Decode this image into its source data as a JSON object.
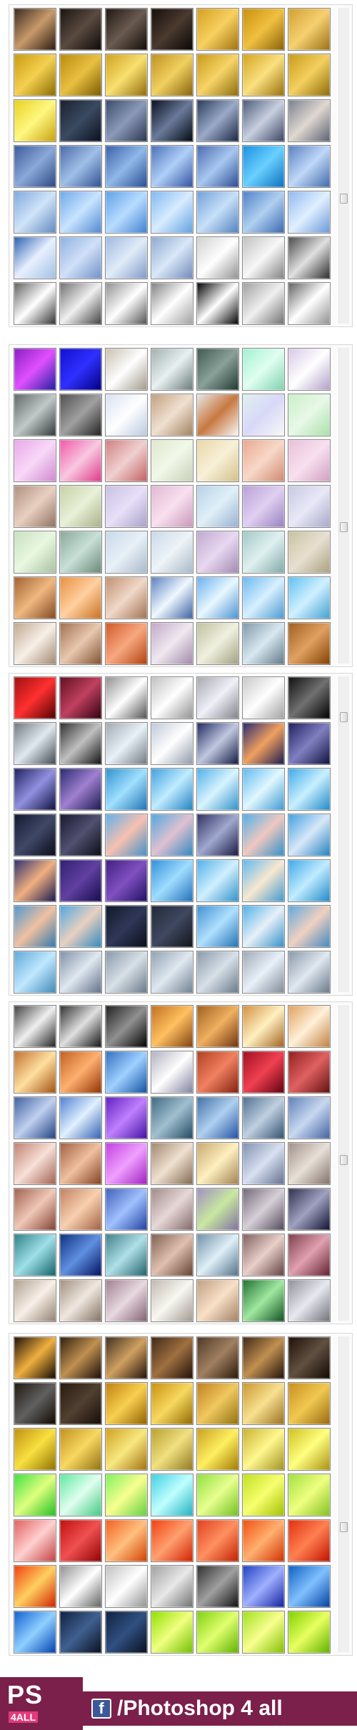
{
  "footer": {
    "logo_ps": "PS",
    "logo_4all": "4ALL",
    "facebook_icon": "f",
    "handle": "/Photoshop 4 all",
    "brand_color": "#7b1f4b"
  },
  "panels": [
    {
      "scroll_fraction": 0.62,
      "swatches": [
        "#3a2a20,#c89a6a,#2a1a10",
        "#1a1410,#5a4a40,#0e0a08",
        "#201812,#6a5a50,#120c08",
        "#160e0a,#4a3a30,#0a0604",
        "#d4a020,#f8d060,#a07010",
        "#c89010,#f0c040,#8a6008",
        "#d0a030,#f6d070,#9a7018",
        "#c89a10,#f4d050,#8a6a00",
        "#b88a10,#e8c040,#7a5a00",
        "#d0a020,#f8e070,#906a08",
        "#c09020,#f0d060,#86620a",
        "#c89818,#f6d468,#8c6a0a",
        "#d4a420,#fae080,#986e0a",
        "#c89a18,#f4d060,#8c6a08",
        "#e8d020,#fff880,#c8a010",
        "#1a2030,#3a4a60,#0a1020",
        "#3a4a6a,#8a9ab8,#2a3450",
        "#0a1020,#6a7a9a,#000810",
        "#2a3a5a,#9aaac8,#1a2440",
        "#4a5a7a,#c8d0e0,#3a4460",
        "#7a8090,#e0d8d0,#5a6070",
        "#3a5a9a,#8aa8d8,#2a4880",
        "#4a6aa8,#a0c0e8,#305090",
        "#3a60a8,#90b8e8,#284c90",
        "#4a70b8,#b0d0f8,#3050a0",
        "#4a6ab0,#a8c8f0,#2a4a90",
        "#1a90e0,#6ad0ff,#0a70c0",
        "#5a80c0,#c0d8f8,#4068a8",
        "#80a8e0,#d0e4f8,#6088c0",
        "#70a8e8,#c8e4ff,#5088d0",
        "#60a0e8,#b8dcff,#4080d0",
        "#80b8f0,#d8ecff,#60a0e0",
        "#70a0d8,#c8e0f8,#5080c0",
        "#5080c8,#b0d0f0,#3a68b0",
        "#90b8f0,#e0f0ff,#6a98d8",
        "#2a60b0,#e8f0ff,#a0c0e0",
        "#90b0e0,#d0e0f8,#7090c8",
        "#a0b8e0,#e0ecf8,#8098c8",
        "#90a8d0,#d8e8f8,#7088b8",
        "#d0d0d0,#ffffff,#909090",
        "#c0c0c0,#f8f8f8,#808080",
        "#4a4a4a,#e0e0e0,#2a2a2a",
        "#606060,#ffffff,#303030",
        "#707070,#f0f0f0,#404040",
        "#909090,#ffffff,#505050",
        "#808080,#ffffff,#a0a0a0",
        "#000000,#ffffff,#000000",
        "#a0a0a0,#f0f0f0,#707070",
        "#606060,#ffffff,#909090"
      ]
    },
    {
      "scroll_fraction": 0.58,
      "swatches": [
        "#8a20c0,#e050ff,#2020a0",
        "#1010d0,#3030ff,#000080",
        "#c8c0b0,#ffffff,#a09888",
        "#a0b0b0,#e8f0f0,#6a7a7a",
        "#405a50,#8aa098,#203a30",
        "#a0f0d0,#e0fff0,#80d0b0",
        "#d8c8e8,#ffffff,#b0a0c8",
        "#606868,#c0c8c8,#303838",
        "#505050,#a0a0a0,#202020",
        "#d8e0f0,#ffffff,#b8c8e0",
        "#c0a080,#f0e0d0,#a08060",
        "#e8e8e8,#c87840,#f8f8f8",
        "#e0f0f0,#d8d8f8,#f8f8f8",
        "#c8f0c8,#e8f8e8,#a8e0a8",
        "#e8a8e8,#f8d8f8,#d088d0",
        "#f058a8,#f8c8e0,#e03888",
        "#d08080,#f0d0d0,#c06060",
        "#e0e8d0,#f0f8e8,#c8d0b8",
        "#e8d8a8,#f8f0d8,#d0c088",
        "#e8a890,#f8d8c8,#d08870",
        "#e8c0d8,#f8e0f0,#d0a0c0",
        "#b09080,#e8d0c0,#907060",
        "#c8d0a8,#e8f0d8,#a8b088",
        "#c8c0e0,#e8e0f8,#a8a0c8",
        "#e0b8d0,#f8e0f0,#c898b8",
        "#b8d0e8,#e0f0f8,#98b0d0",
        "#b8a0d8,#e0d0f0,#9880c0",
        "#c8c8e0,#e8e8f8,#a8a8c8",
        "#c8e0c0,#e8f8e0,#a8c0a0",
        "#88a898,#c8e0d8,#688878",
        "#c8d8e8,#e8f0f8,#a8b8c8",
        "#c8d8e8,#eef4f8,#a8b8c8",
        "#c0a8d0,#e8d8f0,#a088b0",
        "#a0c8c8,#e0f0f0,#80a8a8",
        "#c8c0a0,#e8e0d0,#a8a080",
        "#a06030,#f0b880,#804820",
        "#e89040,#ffd0a0,#c87020",
        "#c09070,#f0d8c8,#a07050",
        "#5a80c0,#f0f8ff,#3a60a0",
        "#6ab0f0,#e8f8ff,#4a90d0",
        "#6ab8f0,#d8f0ff,#4a98d0",
        "#60c0f0,#d0f0ff,#40a0d0",
        "#c0a890,#f8f0e8,#a08870",
        "#a07050,#e8c8b0,#805030",
        "#d05828,#f8a880,#b04010",
        "#c0a8c8,#f0e8f0,#a088a8",
        "#c0c0a0,#f0f0e0,#a0a080",
        "#8098a8,#d8e8f0,#607888",
        "#a06020,#e0a060,#804000"
      ]
    },
    {
      "scroll_fraction": 0.12,
      "swatches": [
        "#a01010,#ff3030,#500000",
        "#601020,#c04060,#300010",
        "#909090,#ffffff,#505050",
        "#c0c0c0,#ffffff,#909090",
        "#a8a8b0,#f0f0f8,#808088",
        "#c8c8c8,#ffffff,#a0a0a0",
        "#101010,#707070,#000000",
        "#707880,#e0e8f0,#404850",
        "#303030,#c0c0c0,#101010",
        "#a0a8b0,#e8f0f8,#707880",
        "#c0c8d8,#ffffff,#9098a8",
        "#202a60,#c0c8e0,#101840",
        "#2a2a70,#f0a060,#1a1a50",
        "#202060,#8080c0,#101040",
        "#202060,#9090e0,#101040",
        "#2a2a70,#a080d0,#1a1a50",
        "#3090d0,#a0e0ff,#2070b0",
        "#40a0e0,#c0ecff,#2080c0",
        "#50b0e8,#d8f4ff,#3090c8",
        "#60b8f0,#e0f8ff,#4098d0",
        "#40a8e8,#c8f0ff,#2088c8",
        "#101830,#404868,#080c18",
        "#181830,#505070,#0c0c18",
        "#60b0e8,#f8c0b0,#4090c8",
        "#50a8e0,#e0c0d0,#3088c0",
        "#303060,#a0a8d0,#181840",
        "#50b0e8,#f0c8c0,#3090c8",
        "#40a0e0,#d8e8f8,#2080c0",
        "#303070,#f0b080,#181850",
        "#302070,#6040a0,#180c50",
        "#402080,#8050c0,#201060",
        "#3090d8,#a0dcff,#2070b8",
        "#50b0e8,#d0f0ff,#3090c8",
        "#60b8f0,#f8e8d0,#4098d0",
        "#40a8e8,#c0ecff,#2088c8",
        "#5098d0,#f0c0a0,#3078b0",
        "#50a8e0,#e8d0c0,#3088c0",
        "#101828,#303858,#080c18",
        "#202838,#404860,#101418",
        "#4090d0,#b0e0ff,#2070b0",
        "#50b0e8,#e8f0f8,#3090c8",
        "#60a8e0,#f0d0c0,#4088c0",
        "#60a8d8,#c0e8ff,#4088b8",
        "#8090a8,#e0e8f0,#607088",
        "#8898a8,#d8e0e8,#687888",
        "#90a0b0,#e0e8f0,#708090",
        "#8898a8,#d8e0e8,#687888",
        "#a0a8b8,#e8f0f8,#808898",
        "#8898a8,#e0e8f0,#687888"
      ]
    },
    {
      "scroll_fraction": 0.5,
      "swatches": [
        "#404040,#f0f0f0,#202020",
        "#303030,#e0e0e0,#101010",
        "#202020,#909090,#000000",
        "#c07020,#ffc060,#804010",
        "#a06020,#f0b060,#703010",
        "#d09040,#fff0c0,#a06020",
        "#e0a060,#fff0d8,#c08040",
        "#c07030,#ffe0a0,#a05010",
        "#c06020,#ffb070,#903000",
        "#3070c0,#a0d0ff,#1050a0",
        "#b0b0c0,#ffffff,#8080a0",
        "#b04020,#f08060,#802010",
        "#a01020,#f04050,#600010",
        "#902020,#e06060,#601010",
        "#4060a0,#c0d0f0,#204080",
        "#5080d0,#e0f0ff,#3060b0",
        "#6020c0,#c080ff,#4010a0",
        "#406880,#a0c0d0,#204860",
        "#4070a8,#b0d0f0,#2050a0",
        "#507090,#c0d0e0,#305070",
        "#6080b8,#c8d8f0,#4060a0",
        "#c08070,#f8e0d8,#a06050",
        "#a06040,#f0c0a0,#804020",
        "#c040e0,#f0a0ff,#a020c0",
        "#a08870,#f0e0d0,#806850",
        "#c8a870,#fff0c0,#a08050",
        "#8090b0,#d8e0f0,#607090",
        "#a09088,#e8e0d8,#807068",
        "#a06050,#f0c8b8,#804030",
        "#c08060,#f8d0b0,#a06040",
        "#4060b8,#a0c0ff,#2040a0",
        "#a08888,#e8d8d8,#806868",
        "#a090c0,#c8e8a0,#8070a0",
        "#706878,#d8d0d8,#504858",
        "#303050,#a0a0c0,#101030",
        "#308088,#a0e0e8,#106068",
        "#103080,#6090e0,#001060",
        "#408088,#b0e0e8,#206068",
        "#806050,#e0c0b0,#604030",
        "#7090a8,#e0f0f8,#507088",
        "#806060,#e8d0c8,#604040",
        "#804050,#e0a0b0,#602030",
        "#b0a090,#f8f0e8,#908070",
        "#a09080,#f0e8e0,#807060",
        "#a08090,#e8d8e0,#806070",
        "#c0b8b0,#f8f8f0,#a09890",
        "#c0a080,#f8e0c8,#a08060",
        "#207030,#a0e8a0,#105020",
        "#909098,#e8e8f0,#707078"
      ]
    },
    {
      "scroll_fraction": 0.62,
      "swatches": [
        "#201008,#f0b040,#100800",
        "#302010,#c09050,#180c08",
        "#403020,#d0a060,#201008",
        "#402818,#a07040,#201008",
        "#503828,#a08060,#281808",
        "#402818,#c09050,#201008",
        "#201008,#605040,#100800",
        "#201810,#606060,#100800",
        "#281810,#504030,#180c08",
        "#c08010,#f8d050,#906000",
        "#c89010,#f8d860,#906800",
        "#c08020,#f0c860,#907010",
        "#c89830,#f8e090,#987020",
        "#c89020,#f0c850,#986810",
        "#c09010,#f8e040,#907000",
        "#c09020,#f8d860,#907010",
        "#d0a020,#f8e880,#a07010",
        "#b8a030,#f0e080,#907820",
        "#c8a020,#fff060,#a07800",
        "#c8b030,#fff890,#a09020",
        "#d0c020,#ffff80,#a89010",
        "#40e040,#e0ff80,#20c020",
        "#60e8a0,#e0fff0,#40c880",
        "#80f060,#f8ff90,#60d040",
        "#40d0e0,#c0ffff,#20b0c0",
        "#90e040,#e8ff90,#70c020",
        "#c0e020,#f8ff70,#a0c000",
        "#a0e040,#f0ff80,#80c020",
        "#e06060,#ffd0d0,#c04040",
        "#c01010,#f05050,#900000",
        "#f06020,#ffc080,#d04000",
        "#f04010,#ffa070,#d02000",
        "#e04020,#ff9060,#c02000",
        "#f05010,#ffb070,#d03000",
        "#e03010,#ff8050,#c01000",
        "#f04010,#ffd060,#d02000",
        "#909090,#ffffff,#606060",
        "#c0c0c0,#ffffff,#909090",
        "#a0a0a0,#e8e8e8,#707070",
        "#303030,#a0a0a0,#101010",
        "#2040c0,#a0b0ff,#1020a0",
        "#1060c0,#80c0ff,#0040a0",
        "#1060d0,#90d0ff,#0040b0",
        "#102040,#406090,#081020",
        "#102040,#305080,#081020",
        "#90e000,#f0ff80,#70c000",
        "#80d010,#e0ff70,#60b000",
        "#a0e020,#f8ff90,#80c000",
        "#80d000,#e8ff60,#60b000"
      ]
    }
  ]
}
